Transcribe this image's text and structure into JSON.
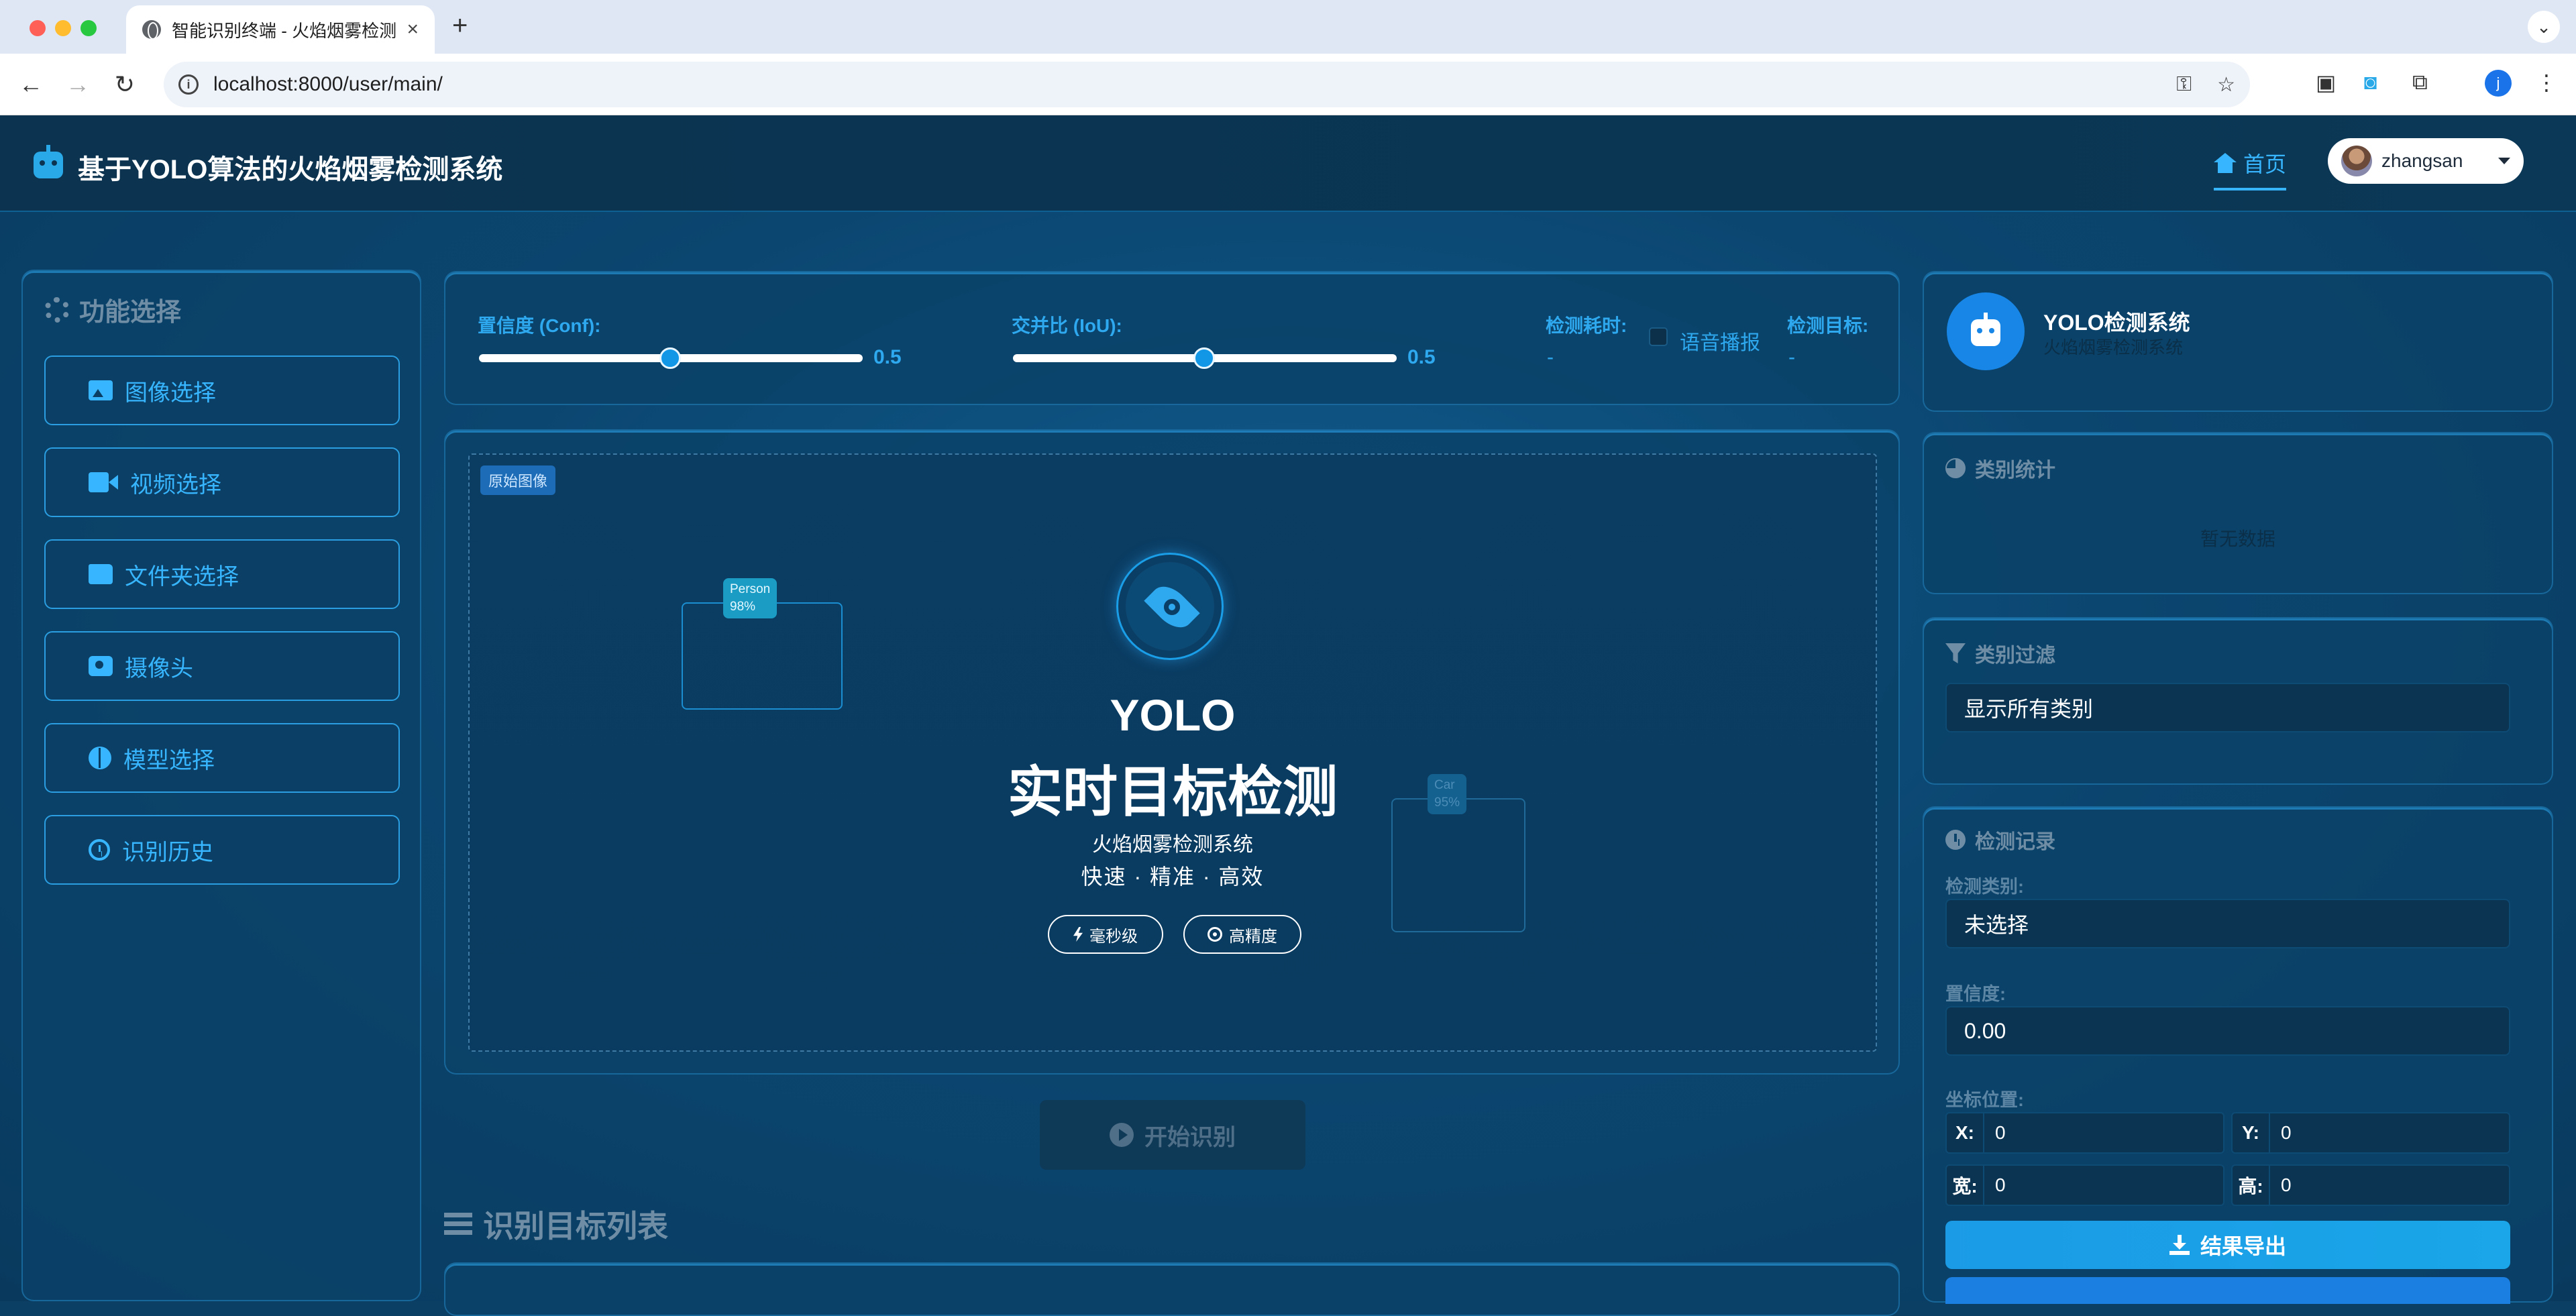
{
  "browser": {
    "tab_title": "智能识别终端 - 火焰烟雾检测系统",
    "tab_close": "×",
    "new_tab": "+",
    "tab_menu": "⌄",
    "url": "localhost:8000/user/main/",
    "profile_initial": "j"
  },
  "header": {
    "title": "基于YOLO算法的火焰烟雾检测系统",
    "home_label": "首页",
    "username": "zhangsan",
    "accent_color": "#37b6ff"
  },
  "sidebar": {
    "title": "功能选择",
    "items": [
      {
        "label": "图像选择",
        "icon": "image-icon"
      },
      {
        "label": "视频选择",
        "icon": "video-icon"
      },
      {
        "label": "文件夹选择",
        "icon": "folder-icon"
      },
      {
        "label": "摄像头",
        "icon": "camera-icon"
      },
      {
        "label": "模型选择",
        "icon": "brain-icon"
      },
      {
        "label": "识别历史",
        "icon": "history-icon"
      }
    ]
  },
  "params": {
    "conf_label": "置信度 (Conf):",
    "conf_value": "0.5",
    "iou_label": "交并比 (IoU):",
    "iou_value": "0.5",
    "time_label": "检测耗时:",
    "time_value": "-",
    "voice_label": "语音播报",
    "voice_checked": false,
    "target_label": "检测目标:",
    "target_value": "-"
  },
  "canvas": {
    "tag": "原始图像",
    "box1_label": "Person",
    "box1_conf": "98%",
    "box2_label": "Car",
    "box2_conf": "95%",
    "yolo": "YOLO",
    "title": "实时目标检测",
    "subtitle": "火焰烟雾检测系统",
    "tagline": "快速 · 精准 · 高效",
    "chip1": "毫秒级",
    "chip2": "高精度"
  },
  "actions": {
    "start_label": "开始识别",
    "list_title": "识别目标列表"
  },
  "right": {
    "sys_name": "YOLO检测系统",
    "sys_sub": "火焰烟雾检测系统",
    "stats_title": "类别统计",
    "stats_empty": "暂无数据",
    "filter_title": "类别过滤",
    "filter_value": "显示所有类别",
    "record_title": "检测记录",
    "det_class_label": "检测类别:",
    "det_class_value": "未选择",
    "conf_label": "置信度:",
    "conf_value": "0.00",
    "coord_label": "坐标位置:",
    "x_label": "X:",
    "x_value": "0",
    "y_label": "Y:",
    "y_value": "0",
    "w_label": "宽:",
    "w_value": "0",
    "h_label": "高:",
    "h_value": "0",
    "export_label": "结果导出"
  }
}
